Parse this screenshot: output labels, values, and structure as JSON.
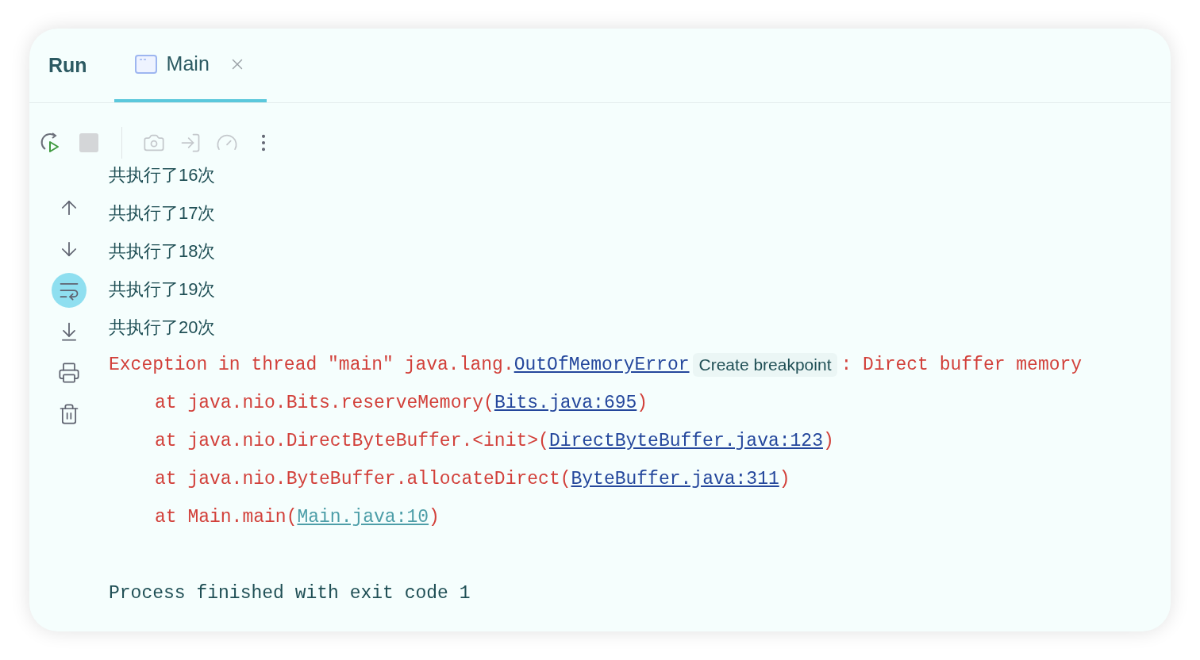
{
  "panel": {
    "title": "Run"
  },
  "tabs": [
    {
      "label": "Main",
      "selected": true,
      "closable": true
    }
  ],
  "toolbar": [
    {
      "kind": "rerun",
      "disabled": false
    },
    {
      "kind": "stop",
      "disabled": true
    },
    {
      "kind": "separator",
      "disabled": false
    },
    {
      "kind": "screenshot",
      "disabled": true
    },
    {
      "kind": "attach",
      "disabled": true
    },
    {
      "kind": "profiler",
      "disabled": true
    },
    {
      "kind": "more",
      "disabled": false
    }
  ],
  "side_tools": [
    {
      "kind": "up",
      "selected": false
    },
    {
      "kind": "down",
      "selected": false
    },
    {
      "kind": "soft-wrap",
      "selected": true
    },
    {
      "kind": "scroll-end",
      "selected": false
    },
    {
      "kind": "print",
      "selected": false
    },
    {
      "kind": "clear",
      "selected": false
    }
  ],
  "console": [
    {
      "kind": "stdout",
      "parts": [
        {
          "kind": "text",
          "text": "共执行了16次"
        }
      ]
    },
    {
      "kind": "stdout",
      "parts": [
        {
          "kind": "text",
          "text": "共执行了17次"
        }
      ]
    },
    {
      "kind": "stdout",
      "parts": [
        {
          "kind": "text",
          "text": "共执行了18次"
        }
      ]
    },
    {
      "kind": "stdout",
      "parts": [
        {
          "kind": "text",
          "text": "共执行了19次"
        }
      ]
    },
    {
      "kind": "stdout",
      "parts": [
        {
          "kind": "text",
          "text": "共执行了20次"
        }
      ]
    },
    {
      "kind": "stderr",
      "parts": [
        {
          "kind": "text",
          "text": "Exception in thread \"main\" java.lang."
        },
        {
          "kind": "link",
          "text": "OutOfMemoryError"
        },
        {
          "kind": "hint",
          "text": "Create breakpoint"
        },
        {
          "kind": "text",
          "text": ": Direct buffer memory"
        }
      ]
    },
    {
      "kind": "stack",
      "parts": [
        {
          "kind": "text",
          "text": "at java.nio.Bits.reserveMemory("
        },
        {
          "kind": "link",
          "text": "Bits.java:695"
        },
        {
          "kind": "text",
          "text": ")"
        }
      ]
    },
    {
      "kind": "stack",
      "parts": [
        {
          "kind": "text",
          "text": "at java.nio.DirectByteBuffer.<init>("
        },
        {
          "kind": "link",
          "text": "DirectByteBuffer.java:123"
        },
        {
          "kind": "text",
          "text": ")"
        }
      ]
    },
    {
      "kind": "stack",
      "parts": [
        {
          "kind": "text",
          "text": "at java.nio.ByteBuffer.allocateDirect("
        },
        {
          "kind": "link",
          "text": "ByteBuffer.java:311"
        },
        {
          "kind": "text",
          "text": ")"
        }
      ]
    },
    {
      "kind": "stack",
      "parts": [
        {
          "kind": "text",
          "text": "at Main.main("
        },
        {
          "kind": "project-link",
          "text": "Main.java:10"
        },
        {
          "kind": "text",
          "text": ")"
        }
      ]
    },
    {
      "kind": "system",
      "parts": [
        {
          "kind": "text",
          "text": "Process finished with exit code 1"
        }
      ]
    }
  ]
}
